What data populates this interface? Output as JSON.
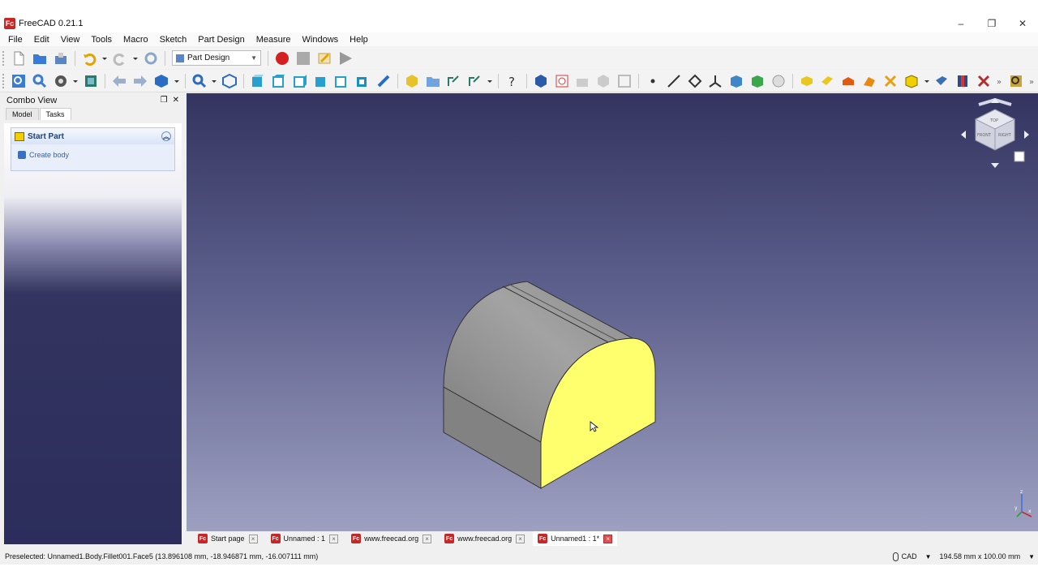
{
  "window": {
    "title": "FreeCAD 0.21.1",
    "app_icon_text": "Fc",
    "controls": [
      "–",
      "❐",
      "✕"
    ]
  },
  "menu": [
    "File",
    "Edit",
    "View",
    "Tools",
    "Macro",
    "Sketch",
    "Part Design",
    "Measure",
    "Windows",
    "Help"
  ],
  "workbench": {
    "selected": "Part Design"
  },
  "combo_view": {
    "title": "Combo View",
    "tabs": [
      "Model",
      "Tasks"
    ],
    "active_tab": "Tasks",
    "task_panel": {
      "title": "Start Part",
      "action": "Create body"
    }
  },
  "document_tabs": [
    {
      "label": "Start page",
      "active": false
    },
    {
      "label": "Unnamed : 1",
      "active": false
    },
    {
      "label": "www.freecad.org",
      "active": false
    },
    {
      "label": "www.freecad.org",
      "active": false
    },
    {
      "label": "Unnamed1 : 1*",
      "active": true
    }
  ],
  "status": {
    "preselected": "Preselected: Unnamed1.Body.Fillet001.Face5 (13.896108 mm, -18.946871 mm, -16.007111 mm)",
    "nav_style": "CAD",
    "dimensions": "194.58 mm x 100.00 mm"
  },
  "navcube": {
    "faces": [
      "TOP",
      "FRONT",
      "RIGHT"
    ]
  },
  "axis": {
    "labels": [
      "z",
      "y",
      "x"
    ]
  },
  "colors": {
    "viewport_top": "#33345f",
    "viewport_bottom": "#9da0c1",
    "selected_face": "#ffff6e",
    "body_gray": "#9a9a9a"
  }
}
